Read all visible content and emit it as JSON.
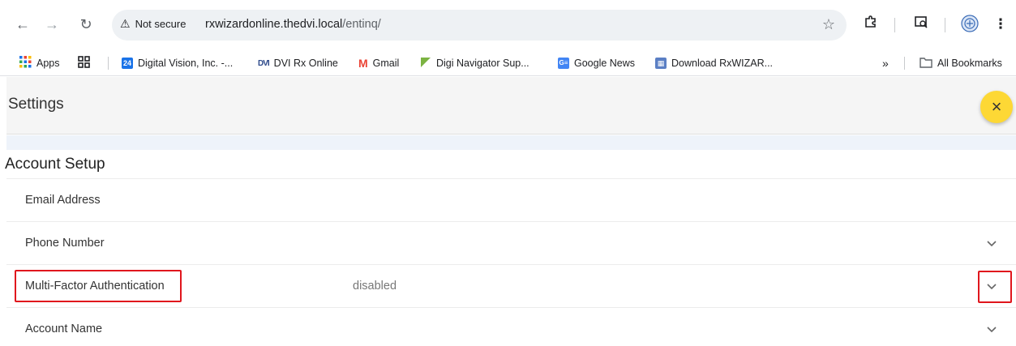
{
  "browser": {
    "security_label": "Not secure",
    "url_host": "rxwizardonline.thedvi.local",
    "url_path": "/entinq/"
  },
  "bookmarks": [
    {
      "label": "Apps",
      "icon": "apps-grid-icon"
    },
    {
      "label": "",
      "icon": "tab-groups-icon"
    },
    {
      "label": "Digital Vision, Inc. -...",
      "icon": "calendar-24-icon"
    },
    {
      "label": "DVI Rx Online",
      "icon": "dvi-logo-icon"
    },
    {
      "label": "Gmail",
      "icon": "gmail-icon"
    },
    {
      "label": "Digi Navigator Sup...",
      "icon": "green-flag-icon"
    },
    {
      "label": "Google News",
      "icon": "google-news-icon"
    },
    {
      "label": "Download RxWIZAR...",
      "icon": "rxwizard-icon"
    },
    {
      "label": "All Bookmarks",
      "icon": "folder-icon"
    }
  ],
  "app": {
    "title": "Settings",
    "close_label": "×"
  },
  "section": {
    "title": "Account Setup"
  },
  "rows": [
    {
      "label": "Email Address",
      "value": "",
      "chevron": false
    },
    {
      "label": "Phone Number",
      "value": "",
      "chevron": true
    },
    {
      "label": "Multi-Factor Authentication",
      "value": "disabled",
      "chevron": true
    },
    {
      "label": "Account Name",
      "value": "",
      "chevron": true
    }
  ],
  "colors": {
    "fab": "#fdd835",
    "highlight": "#e0161d",
    "header_bg": "#f5f5f5"
  }
}
